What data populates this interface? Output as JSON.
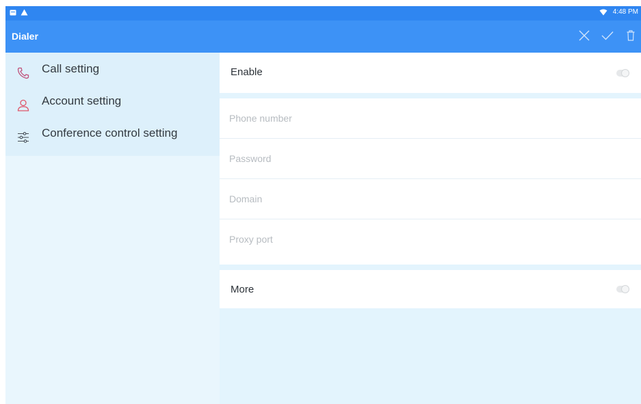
{
  "status_bar": {
    "time": "4:48 PM",
    "left_icons": [
      "notification-square-icon",
      "warning-triangle-icon"
    ],
    "right_icons": [
      "wifi-icon"
    ]
  },
  "app_bar": {
    "title": "Dialer",
    "actions": [
      "close-icon",
      "check-icon",
      "delete-icon"
    ]
  },
  "sidebar": {
    "items": [
      {
        "label": "Call setting",
        "icon": "phone-icon",
        "icon_color": "#c0507a"
      },
      {
        "label": "Account setting",
        "icon": "person-icon",
        "icon_color": "#e0566a"
      },
      {
        "label": "Conference control setting",
        "icon": "sliders-icon",
        "icon_color": "#444b52"
      }
    ]
  },
  "main": {
    "enable": {
      "label": "Enable",
      "checked": false
    },
    "fields": [
      {
        "placeholder": "Phone number",
        "value": ""
      },
      {
        "placeholder": "Password",
        "value": ""
      },
      {
        "placeholder": "Domain",
        "value": ""
      },
      {
        "placeholder": "Proxy port",
        "value": ""
      }
    ],
    "more": {
      "label": "More",
      "checked": false
    }
  },
  "colors": {
    "app_bar": "#3d92f6",
    "status_bar": "#2f86f1",
    "sidebar_selected_bg": "#ddf0fb",
    "panel_bg": "#e3f4fd"
  }
}
